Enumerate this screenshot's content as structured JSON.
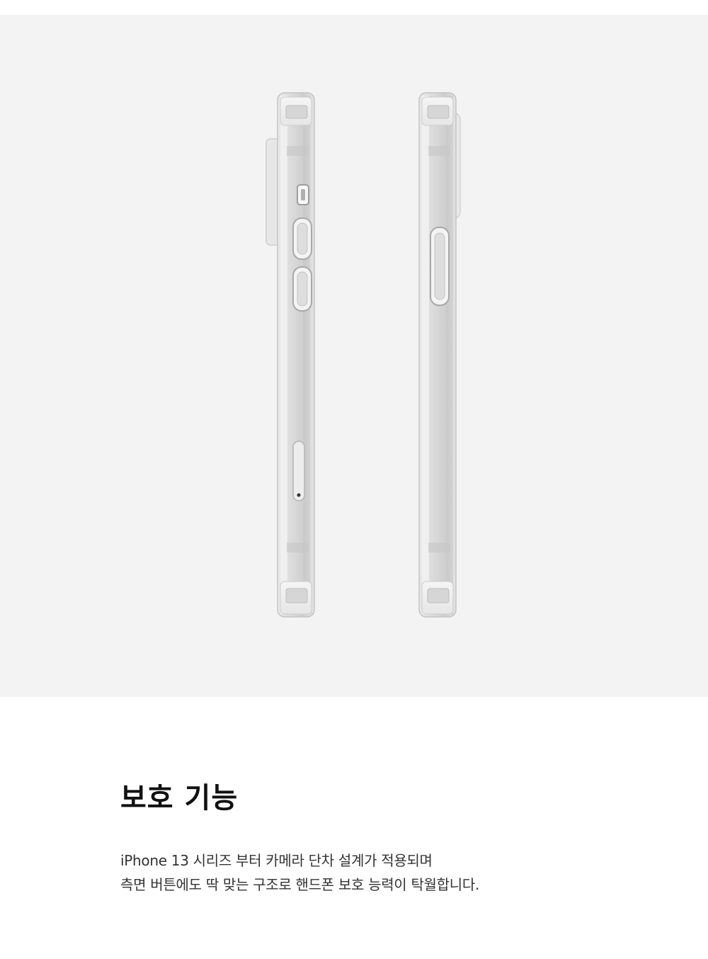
{
  "section": {
    "title": "보호 기능",
    "description_lines": [
      "iPhone 13 시리즈 부터 카메라 단차 설계가 적용되며",
      "측면 버튼에도 딱 맞는 구조로 핸드폰 보호 능력이 탁월합니다."
    ]
  },
  "colors": {
    "photo_background": "#f3f3f3",
    "page_background": "#ffffff",
    "title_text": "#111111",
    "body_text": "#333333"
  }
}
